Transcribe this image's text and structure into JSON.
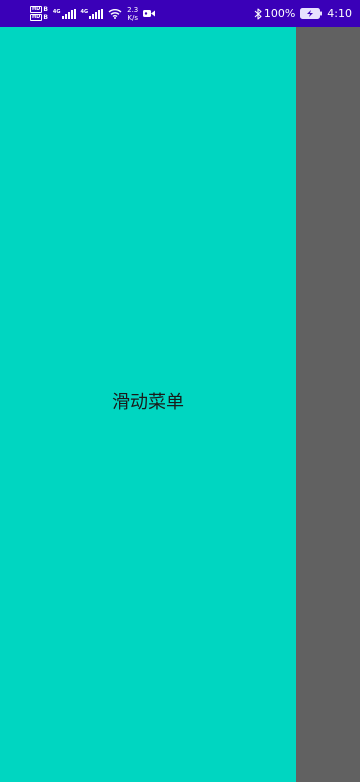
{
  "status_bar": {
    "hd_top": "HD",
    "hd_top_sub": "B",
    "hd_bottom": "HD",
    "hd_bottom_sub": "B",
    "sim1_label": "4G",
    "sim2_label": "4G",
    "speed_value": "2.3",
    "speed_unit": "K/s",
    "battery_percent": "100%",
    "time": "4:10"
  },
  "drawer": {
    "title": "滑动菜单",
    "background": "#00d6c1"
  },
  "colors": {
    "status_bar": "#3a00b8",
    "scrim": "#616161"
  }
}
